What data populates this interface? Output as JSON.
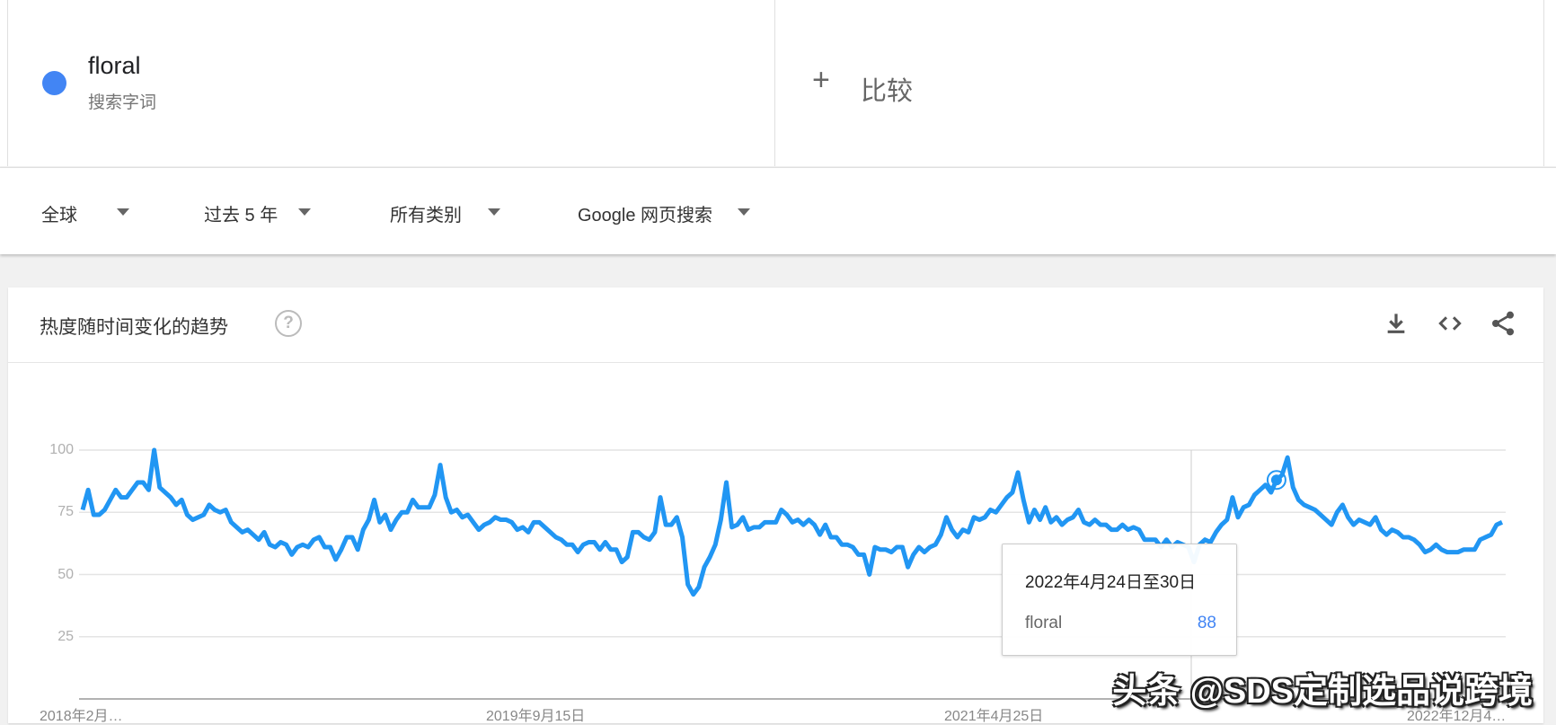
{
  "search_term": {
    "name": "floral",
    "type_label": "搜索字词",
    "color": "#4285f4"
  },
  "compare": {
    "label": "比较"
  },
  "filters": [
    {
      "label": "全球"
    },
    {
      "label": "过去 5 年"
    },
    {
      "label": "所有类别"
    },
    {
      "label": "Google 网页搜索"
    }
  ],
  "card": {
    "title": "热度随时间变化的趋势",
    "help": "?"
  },
  "tooltip": {
    "date": "2022年4月24日至30日",
    "term": "floral",
    "value": "88"
  },
  "watermark": "头条 @SDS定制选品说跨境",
  "chart_data": {
    "type": "line",
    "title": "热度随时间变化的趋势",
    "xlabel": "",
    "ylabel": "",
    "ylim": [
      0,
      100
    ],
    "yticks": [
      "25",
      "50",
      "75",
      "100"
    ],
    "xticks": [
      "2018年2月…",
      "2019年9月15日",
      "2021年4月25日",
      "2022年12月4…"
    ],
    "grid": true,
    "series": [
      {
        "name": "floral",
        "color": "#2196f3",
        "values": [
          76,
          84,
          74,
          74,
          76,
          80,
          84,
          81,
          81,
          84,
          87,
          87,
          84,
          100,
          85,
          83,
          81,
          78,
          80,
          74,
          72,
          73,
          74,
          78,
          76,
          75,
          76,
          71,
          69,
          67,
          68,
          66,
          64,
          67,
          62,
          61,
          63,
          62,
          58,
          61,
          62,
          61,
          64,
          65,
          61,
          61,
          56,
          60,
          65,
          65,
          60,
          68,
          72,
          80,
          71,
          74,
          68,
          72,
          75,
          75,
          80,
          77,
          77,
          77,
          82,
          94,
          81,
          75,
          76,
          73,
          74,
          71,
          68,
          70,
          71,
          73,
          72,
          72,
          71,
          68,
          69,
          67,
          71,
          71,
          69,
          67,
          65,
          64,
          62,
          62,
          59,
          62,
          63,
          63,
          60,
          63,
          60,
          60,
          55,
          57,
          67,
          67,
          65,
          64,
          67,
          81,
          70,
          70,
          73,
          65,
          46,
          42,
          45,
          53,
          57,
          62,
          72,
          87,
          69,
          70,
          73,
          68,
          69,
          69,
          71,
          71,
          71,
          76,
          74,
          71,
          72,
          70,
          72,
          70,
          66,
          70,
          65,
          65,
          62,
          62,
          61,
          58,
          58,
          50,
          61,
          60,
          60,
          59,
          61,
          61,
          53,
          58,
          61,
          59,
          61,
          62,
          66,
          73,
          68,
          65,
          68,
          67,
          73,
          72,
          73,
          76,
          75,
          78,
          81,
          83,
          91,
          80,
          71,
          76,
          72,
          77,
          71,
          73,
          70,
          72,
          73,
          76,
          71,
          70,
          72,
          70,
          70,
          68,
          68,
          70,
          68,
          69,
          68,
          64,
          64,
          64,
          61,
          64,
          61,
          63,
          62,
          61,
          55,
          62,
          64,
          63,
          67,
          70,
          72,
          81,
          73,
          77,
          78,
          82,
          84,
          86,
          83,
          88,
          90,
          97,
          85,
          80,
          78,
          77,
          76,
          74,
          72,
          70,
          75,
          78,
          73,
          70,
          72,
          71,
          70,
          73,
          68,
          66,
          68,
          67,
          65,
          65,
          64,
          62,
          59,
          60,
          62,
          60,
          59,
          59,
          59,
          60,
          60,
          60,
          64,
          65,
          66,
          70,
          71
        ]
      }
    ],
    "highlight": {
      "label": "2022年4月24日至30日",
      "value": 88
    }
  }
}
